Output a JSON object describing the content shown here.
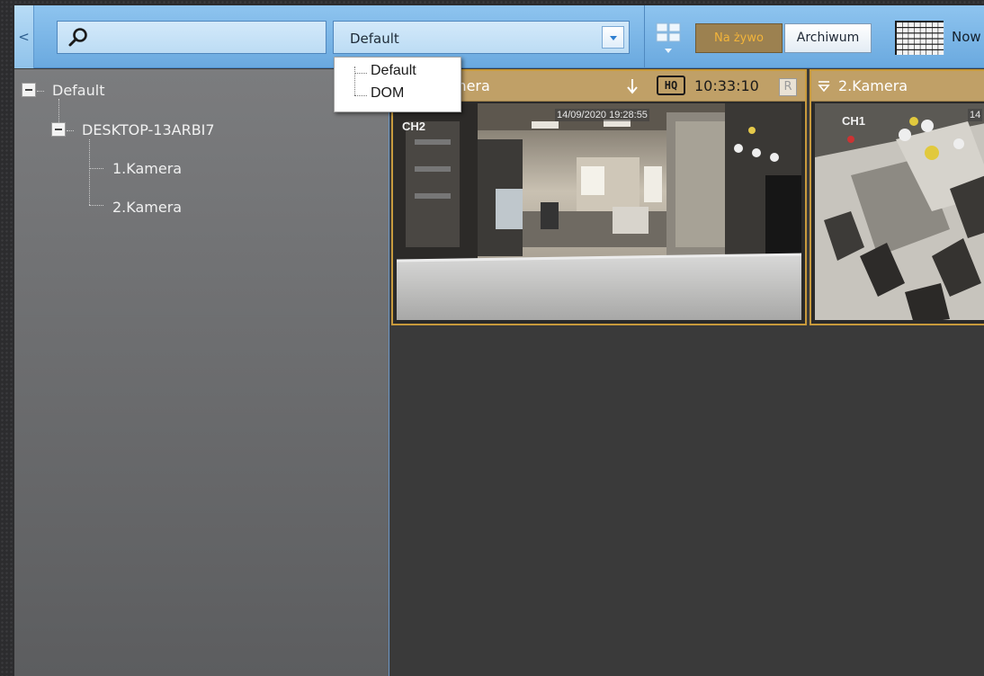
{
  "toolbar": {
    "collapse_glyph": "<",
    "search": {
      "value": "",
      "placeholder": ""
    },
    "layout_combo": {
      "value": "Default"
    },
    "live_button": "Na żywo",
    "archive_button": "Archiwum",
    "new_layout_label": "Now"
  },
  "layout_dropdown": {
    "options": [
      "Default",
      "DOM"
    ],
    "selected": "Default"
  },
  "tree": {
    "root": "Default",
    "server": "DESKTOP-13ARBI7",
    "cameras": [
      "1.Kamera",
      "2.Kamera"
    ]
  },
  "cameras": [
    {
      "title": "1.Kamera",
      "title_visible": "mera",
      "quality": "HQ",
      "time": "10:33:10",
      "rec": "R",
      "osd_timestamp": "14/09/2020 19:28:55",
      "osd_channel": "CH2"
    },
    {
      "title": "2.Kamera",
      "osd_channel": "CH1",
      "osd_timestamp_partial": "14"
    }
  ],
  "colors": {
    "toolbar": "#7ab6e6",
    "panel": "#6e6f71",
    "camera_header": "#c0a067",
    "live_text": "#f2b43a"
  },
  "icons": [
    "search-icon",
    "dropdown-arrow-icon",
    "layout-icon",
    "grid-icon",
    "arrow-down-icon",
    "filter-icon"
  ]
}
